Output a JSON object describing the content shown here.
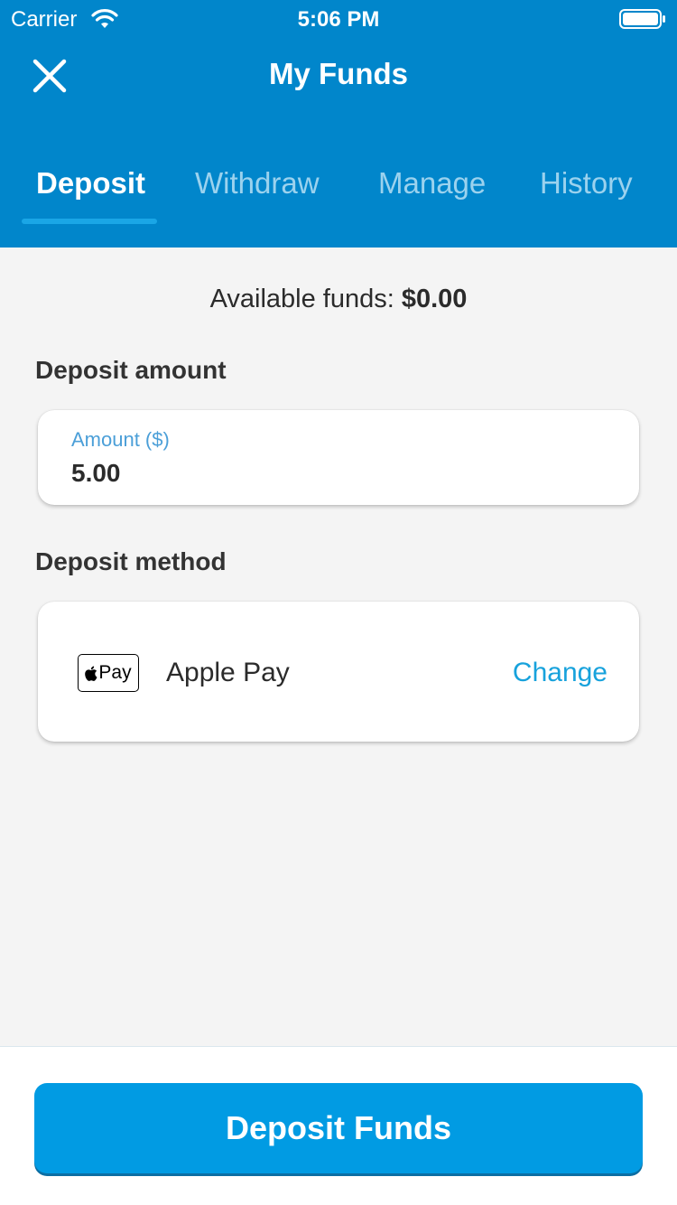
{
  "status_bar": {
    "carrier": "Carrier",
    "time": "5:06 PM",
    "wifi_icon": "wifi-icon",
    "battery_icon": "battery-icon"
  },
  "header": {
    "title": "My Funds",
    "close_icon": "close-icon",
    "background_color": "#0186cb"
  },
  "tabs": [
    {
      "label": "Deposit",
      "active": true
    },
    {
      "label": "Withdraw",
      "active": false
    },
    {
      "label": "Manage",
      "active": false
    },
    {
      "label": "History",
      "active": false
    }
  ],
  "available_funds": {
    "label": "Available funds:",
    "value": "$0.00"
  },
  "deposit_amount": {
    "section_label": "Deposit amount",
    "field_label": "Amount ($)",
    "value": "5.00"
  },
  "deposit_method": {
    "section_label": "Deposit method",
    "method_icon": "apple-pay-icon",
    "method_icon_text": "Pay",
    "method_name": "Apple Pay",
    "change_label": "Change"
  },
  "footer": {
    "button_label": "Deposit Funds",
    "button_color": "#019be3"
  }
}
